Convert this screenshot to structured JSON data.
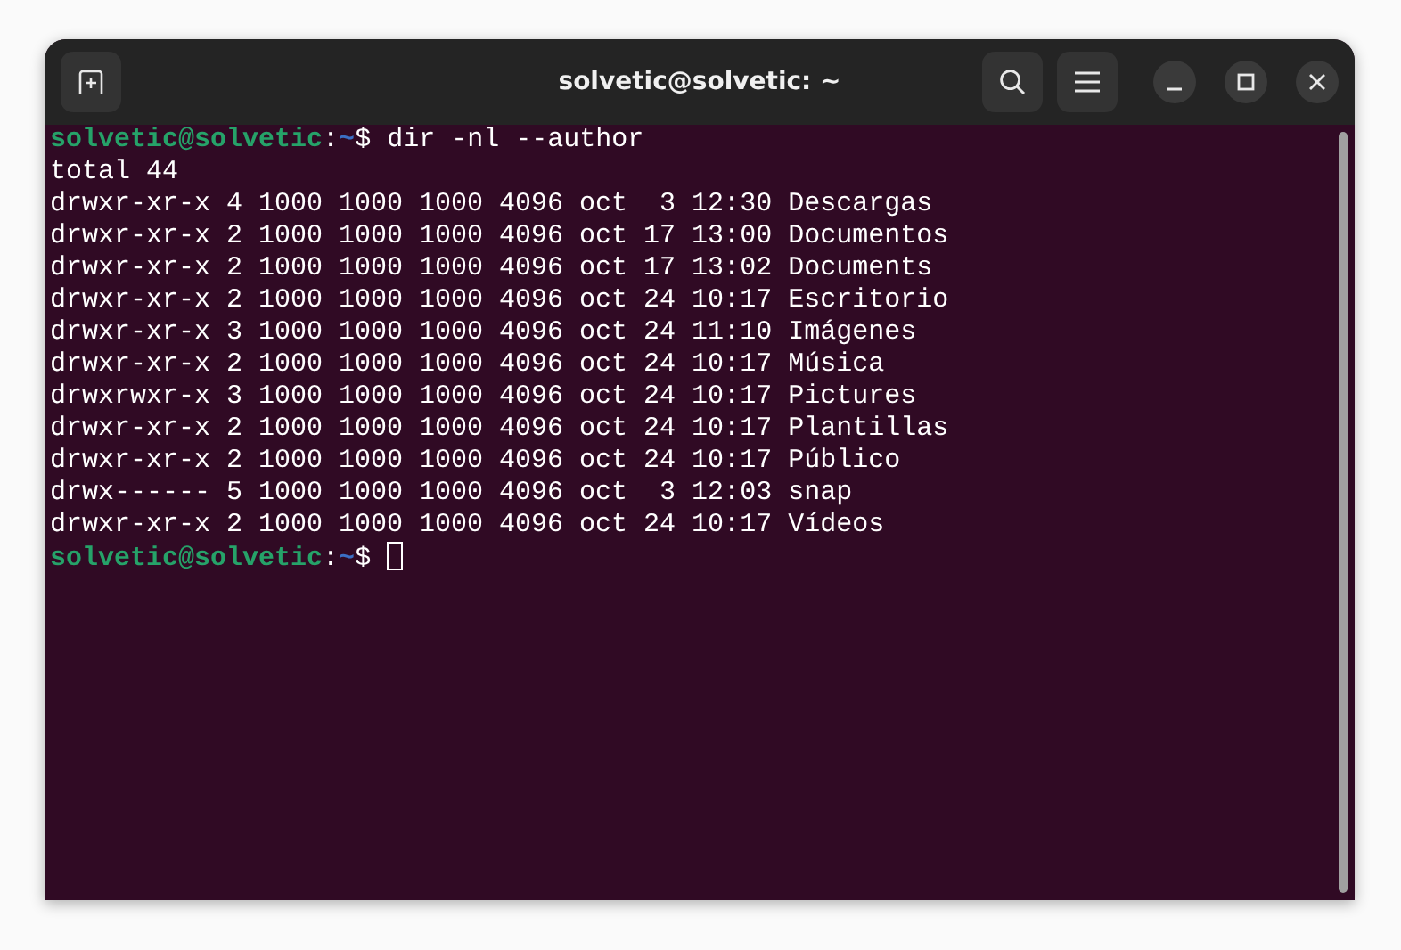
{
  "window": {
    "title": "solvetic@solvetic: ~"
  },
  "terminal": {
    "lines": [
      {
        "kind": "prompt",
        "user_host": "solvetic@solvetic",
        "separator": ":",
        "path": "~",
        "symbol": "$",
        "command": "dir -nl --author",
        "cursor": false
      },
      {
        "kind": "output",
        "text": "total 44"
      },
      {
        "kind": "output",
        "text": "drwxr-xr-x 4 1000 1000 1000 4096 oct  3 12:30 Descargas"
      },
      {
        "kind": "output",
        "text": "drwxr-xr-x 2 1000 1000 1000 4096 oct 17 13:00 Documentos"
      },
      {
        "kind": "output",
        "text": "drwxr-xr-x 2 1000 1000 1000 4096 oct 17 13:02 Documents"
      },
      {
        "kind": "output",
        "text": "drwxr-xr-x 2 1000 1000 1000 4096 oct 24 10:17 Escritorio"
      },
      {
        "kind": "output",
        "text": "drwxr-xr-x 3 1000 1000 1000 4096 oct 24 11:10 Imágenes"
      },
      {
        "kind": "output",
        "text": "drwxr-xr-x 2 1000 1000 1000 4096 oct 24 10:17 Música"
      },
      {
        "kind": "output",
        "text": "drwxrwxr-x 3 1000 1000 1000 4096 oct 24 10:17 Pictures"
      },
      {
        "kind": "output",
        "text": "drwxr-xr-x 2 1000 1000 1000 4096 oct 24 10:17 Plantillas"
      },
      {
        "kind": "output",
        "text": "drwxr-xr-x 2 1000 1000 1000 4096 oct 24 10:17 Público"
      },
      {
        "kind": "output",
        "text": "drwx------ 5 1000 1000 1000 4096 oct  3 12:03 snap"
      },
      {
        "kind": "output",
        "text": "drwxr-xr-x 2 1000 1000 1000 4096 oct 24 10:17 Vídeos"
      },
      {
        "kind": "prompt",
        "user_host": "solvetic@solvetic",
        "separator": ":",
        "path": "~",
        "symbol": "$",
        "cursor": true
      }
    ]
  }
}
